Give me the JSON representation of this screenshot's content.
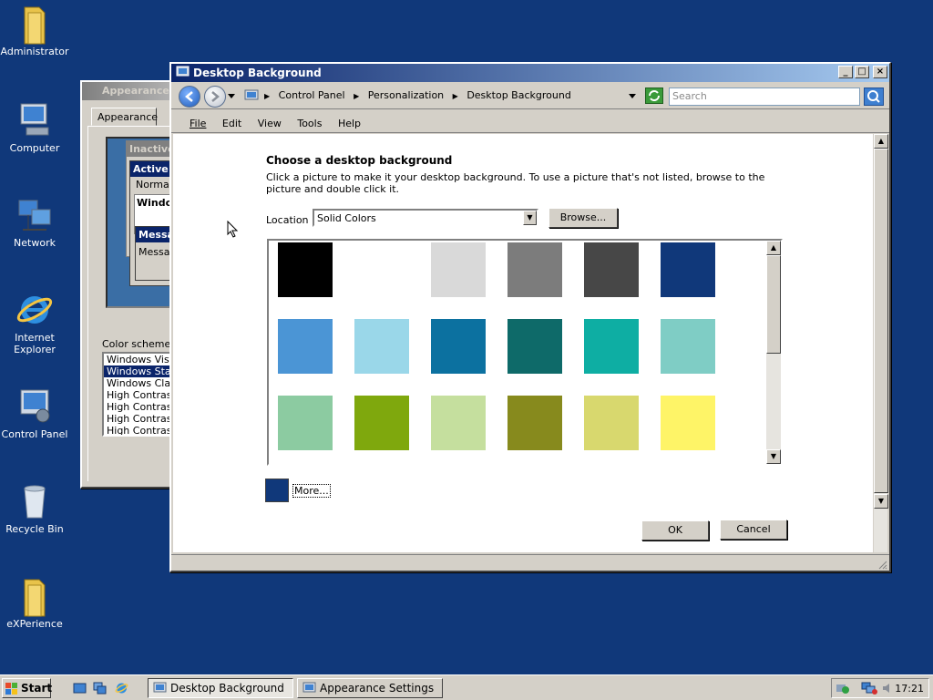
{
  "desktop": {
    "background_color": "#10387a",
    "icons": [
      {
        "label": "Administrator",
        "icon": "folder-user-icon"
      },
      {
        "label": "Computer",
        "icon": "computer-icon"
      },
      {
        "label": "Network",
        "icon": "network-icon"
      },
      {
        "label": "Internet Explorer",
        "icon": "internet-explorer-icon"
      },
      {
        "label": "Control Panel",
        "icon": "control-panel-icon"
      },
      {
        "label": "Recycle Bin",
        "icon": "recycle-bin-icon"
      },
      {
        "label": "eXPerience",
        "icon": "folder-icon"
      }
    ]
  },
  "appearance_window": {
    "title": "Appearance S",
    "tab": "Appearance",
    "preview": {
      "inactive": "Inactive",
      "active": "Active V",
      "normal": "Normal",
      "window": "Window",
      "message": "Messag",
      "message_text": "Messag"
    },
    "color_scheme_label": "Color scheme:",
    "color_schemes": [
      "Windows Vista",
      "Windows Stand",
      "Windows Classi",
      "High Contrast W",
      "High Contrast B",
      "High Contrast -",
      "High Contrast -"
    ],
    "selected_scheme_index": 1
  },
  "desktop_background_window": {
    "title": "Desktop Background",
    "caption_buttons": {
      "minimize": "_",
      "maximize": "□",
      "close": "×"
    },
    "breadcrumb": [
      "Control Panel",
      "Personalization",
      "Desktop Background"
    ],
    "search_placeholder": "Search",
    "menu": [
      "File",
      "Edit",
      "View",
      "Tools",
      "Help"
    ],
    "heading": "Choose a desktop background",
    "description": "Click a picture to make it your desktop background. To use a picture that's not listed, browse to the picture and double click it.",
    "location_label": "Location",
    "location_value": "Solid Colors",
    "browse_button": "Browse...",
    "swatches": [
      [
        "#000000",
        "#ffffff",
        "#d9d9d9",
        "#7c7c7c",
        "#474747",
        "#10387a"
      ],
      [
        "#4b95d5",
        "#9ad7e9",
        "#0c71a0",
        "#0e6a69",
        "#0eaea3",
        "#7fcdc5"
      ],
      [
        "#8ccba1",
        "#7fa80d",
        "#c5df9e",
        "#878a1d",
        "#d8d86e",
        "#fef467"
      ]
    ],
    "selected_color": "#10387a",
    "more_link": "More...",
    "ok_button": "OK",
    "cancel_button": "Cancel"
  },
  "taskbar": {
    "start_label": "Start",
    "tasks": [
      {
        "label": "Desktop Background",
        "active": true
      },
      {
        "label": "Appearance Settings",
        "active": false
      }
    ],
    "clock": "17:21"
  }
}
